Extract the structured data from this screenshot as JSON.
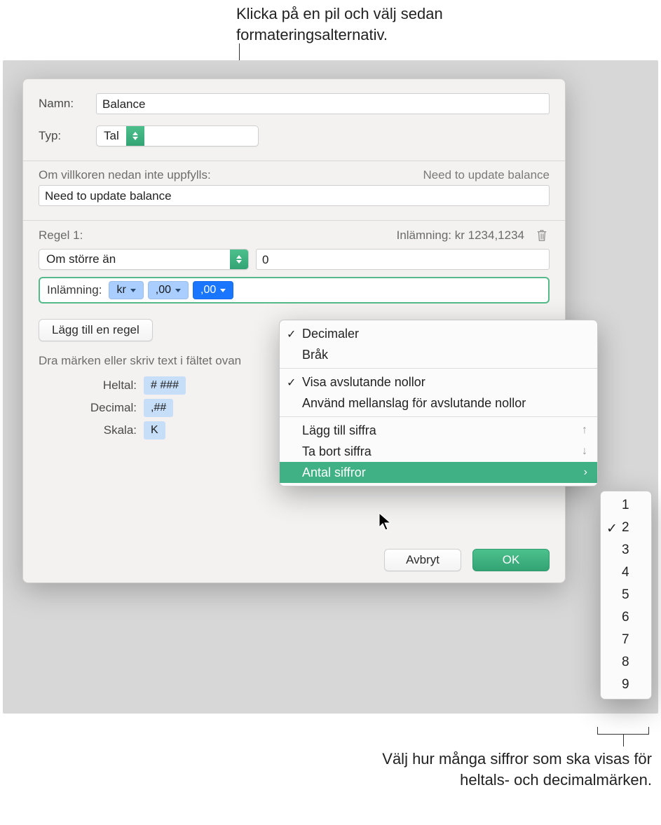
{
  "annotations": {
    "top": "Klicka på en pil och välj sedan formateringsalternativ.",
    "bottom": "Välj hur många siffror som ska visas för heltals- och decimalmärken."
  },
  "dialog": {
    "name_label": "Namn:",
    "name_value": "Balance",
    "type_label": "Typ:",
    "type_value": "Tal",
    "cond_label": "Om villkoren nedan inte uppfylls:",
    "cond_preview": "Need to update balance",
    "cond_value": "Need to update balance",
    "rule1_label": "Regel 1:",
    "rule1_preview": "Inlämning: kr 1234,1234",
    "rule1_op": "Om större än",
    "rule1_val": "0",
    "inl_label": "Inlämning:",
    "tok_currency": "kr",
    "tok_dec1": ",00",
    "tok_dec2": ",00",
    "add_rule": "Lägg till en regel",
    "drag_hint": "Dra märken eller skriv text i fältet ovan",
    "grid": {
      "heltal_label": "Heltal:",
      "heltal_tok": "# ###",
      "decimal_label": "Decimal:",
      "decimal_tok": ",##",
      "skala_label": "Skala:",
      "skala_tok": "K"
    },
    "cancel": "Avbryt",
    "ok": "OK"
  },
  "menu": {
    "decimaler": "Decimaler",
    "brak": "Bråk",
    "visa_nollor": "Visa avslutande nollor",
    "mellanslag": "Använd mellanslag för avslutande nollor",
    "lagg_till": "Lägg till siffra",
    "ta_bort": "Ta bort siffra",
    "antal": "Antal siffror",
    "arrow_up": "↑",
    "arrow_down": "↓",
    "arrow_right": "›"
  },
  "submenu": {
    "items": [
      "1",
      "2",
      "3",
      "4",
      "5",
      "6",
      "7",
      "8",
      "9"
    ],
    "selected": "2"
  }
}
